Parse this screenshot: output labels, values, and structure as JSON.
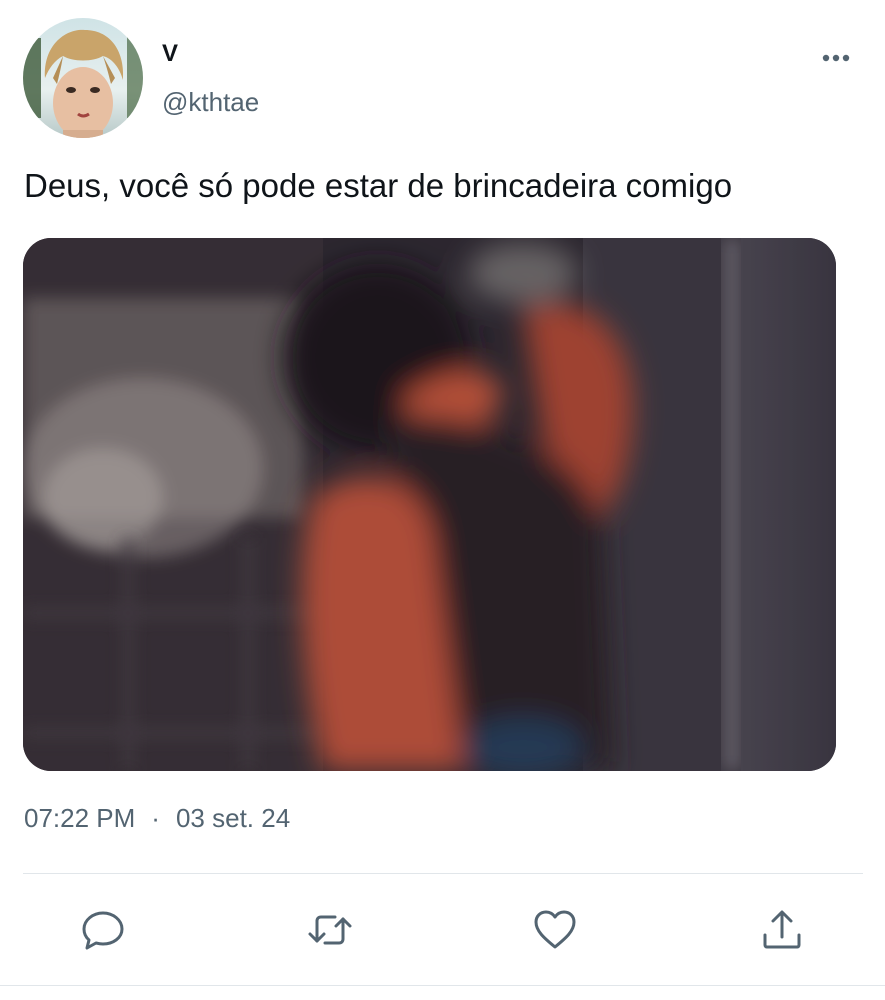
{
  "tweet": {
    "display_name": "V",
    "handle": "@kthtae",
    "text": "Deus, você só pode estar de brincadeira comigo",
    "time": "07:22 PM",
    "separator": "·",
    "date": "03 set. 24"
  },
  "icons": {
    "more": "more-horizontal-icon",
    "reply": "reply-icon",
    "retweet": "retweet-icon",
    "like": "heart-icon",
    "share": "share-icon"
  },
  "colors": {
    "text": "#0f1419",
    "secondary_text": "#536471",
    "icon": "#536471",
    "divider": "#e1e6ea"
  }
}
